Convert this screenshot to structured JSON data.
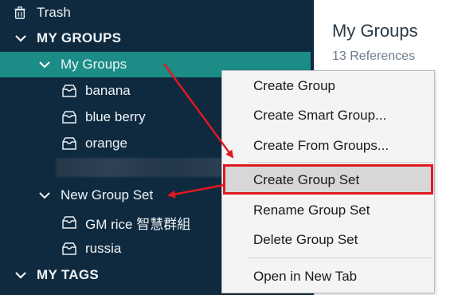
{
  "sidebar": {
    "trash_label": "Trash",
    "my_groups_section": "MY GROUPS",
    "my_groups_item": "My Groups",
    "groups": [
      "banana",
      "blue berry",
      "orange"
    ],
    "group_set": "New Group Set",
    "group_set_children": [
      "GM rice 智慧群組",
      "russia"
    ],
    "my_tags_section": "MY TAGS"
  },
  "pane": {
    "title": "My Groups",
    "subtitle": "13 References"
  },
  "context_menu": {
    "items": [
      "Create Group",
      "Create Smart Group...",
      "Create From Groups...",
      "Create Group Set",
      "Rename Group Set",
      "Delete Group Set",
      "Open in New Tab"
    ],
    "highlighted_item": "Create Group Set"
  },
  "colors": {
    "sidebar_bg": "#0f2a3f",
    "selected_bg": "#1b8c86",
    "annotation_red": "#e0191f"
  }
}
